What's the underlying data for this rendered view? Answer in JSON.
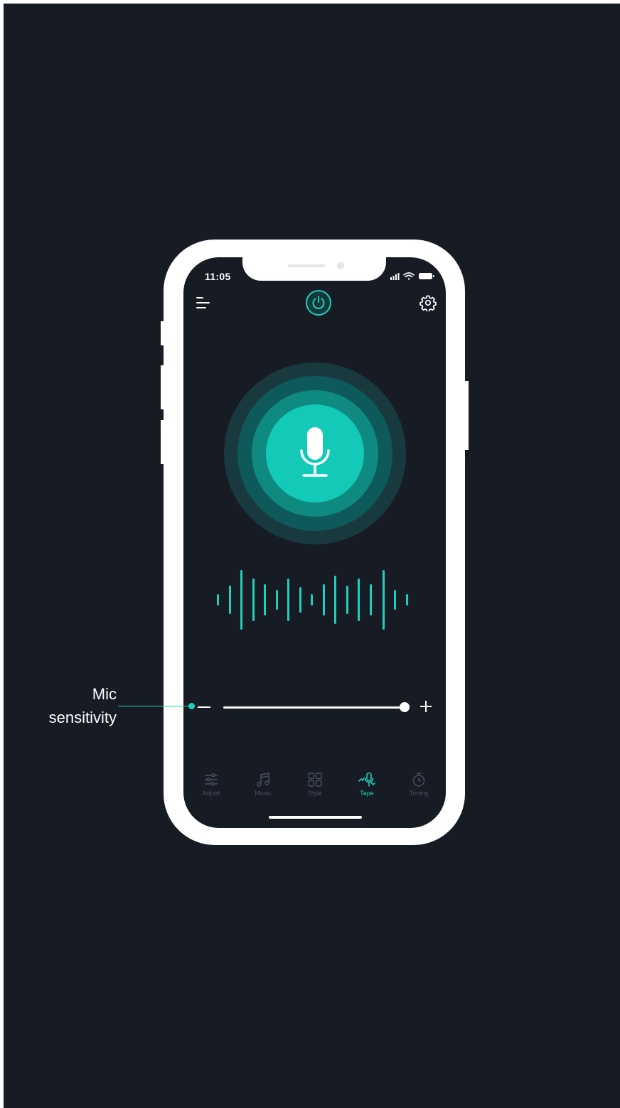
{
  "status_bar": {
    "time": "11:05"
  },
  "header": {
    "menu_icon": "menu-icon",
    "power_icon": "power-icon",
    "settings_icon": "gear-icon"
  },
  "mic": {
    "icon": "microphone-icon"
  },
  "sensitivity": {
    "annotation_line1": "Mic",
    "annotation_line2": "sensitivity",
    "level": 1.0
  },
  "tabs": [
    {
      "label": "Adjust",
      "icon": "sliders-icon",
      "active": false
    },
    {
      "label": "Music",
      "icon": "music-note-icon",
      "active": false
    },
    {
      "label": "Style",
      "icon": "grid-icon",
      "active": false
    },
    {
      "label": "Tape",
      "icon": "tape-mic-icon",
      "active": true
    },
    {
      "label": "Timing",
      "icon": "timer-icon",
      "active": false
    }
  ],
  "colors": {
    "background": "#171b24",
    "accent": "#1ecfbe",
    "inactive": "#4a5160",
    "frame": "#ffffff"
  }
}
